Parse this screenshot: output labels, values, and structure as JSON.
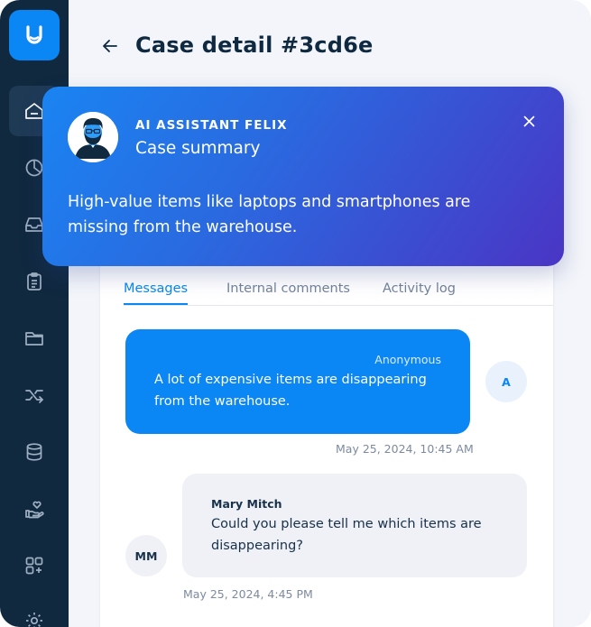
{
  "header": {
    "title": "Case detail #3cd6e"
  },
  "sidebar": {
    "items": [
      {
        "icon": "home-icon",
        "active": true
      },
      {
        "icon": "pie-chart-icon",
        "active": false
      },
      {
        "icon": "inbox-icon",
        "active": false
      },
      {
        "icon": "clipboard-icon",
        "active": false
      },
      {
        "icon": "folder-icon",
        "active": false
      },
      {
        "icon": "shuffle-icon",
        "active": false
      },
      {
        "icon": "database-icon",
        "active": false
      },
      {
        "icon": "hand-heart-icon",
        "active": false
      },
      {
        "icon": "apps-add-icon",
        "active": false
      },
      {
        "icon": "gear-icon",
        "active": false
      }
    ]
  },
  "assistant": {
    "label": "AI ASSISTANT FELIX",
    "title": "Case summary",
    "text": "High-value items like laptops and smartphones are missing from the warehouse."
  },
  "tabs": [
    {
      "label": "Messages",
      "active": true
    },
    {
      "label": "Internal comments",
      "active": false
    },
    {
      "label": "Activity log",
      "active": false
    }
  ],
  "messages": [
    {
      "sender": "Anonymous",
      "text": "A lot of expensive items are disappearing from the warehouse.",
      "avatar": "A",
      "timestamp": "May 25, 2024, 10:45 AM"
    },
    {
      "sender": "Mary Mitch",
      "text": "Could you please tell me which items are disappearing?",
      "avatar": "MM",
      "timestamp": "May 25, 2024, 4:45 PM"
    }
  ],
  "colors": {
    "sidebar": "#10293f",
    "accent": "#0a86f5",
    "gradient_end": "#4a35c5"
  }
}
